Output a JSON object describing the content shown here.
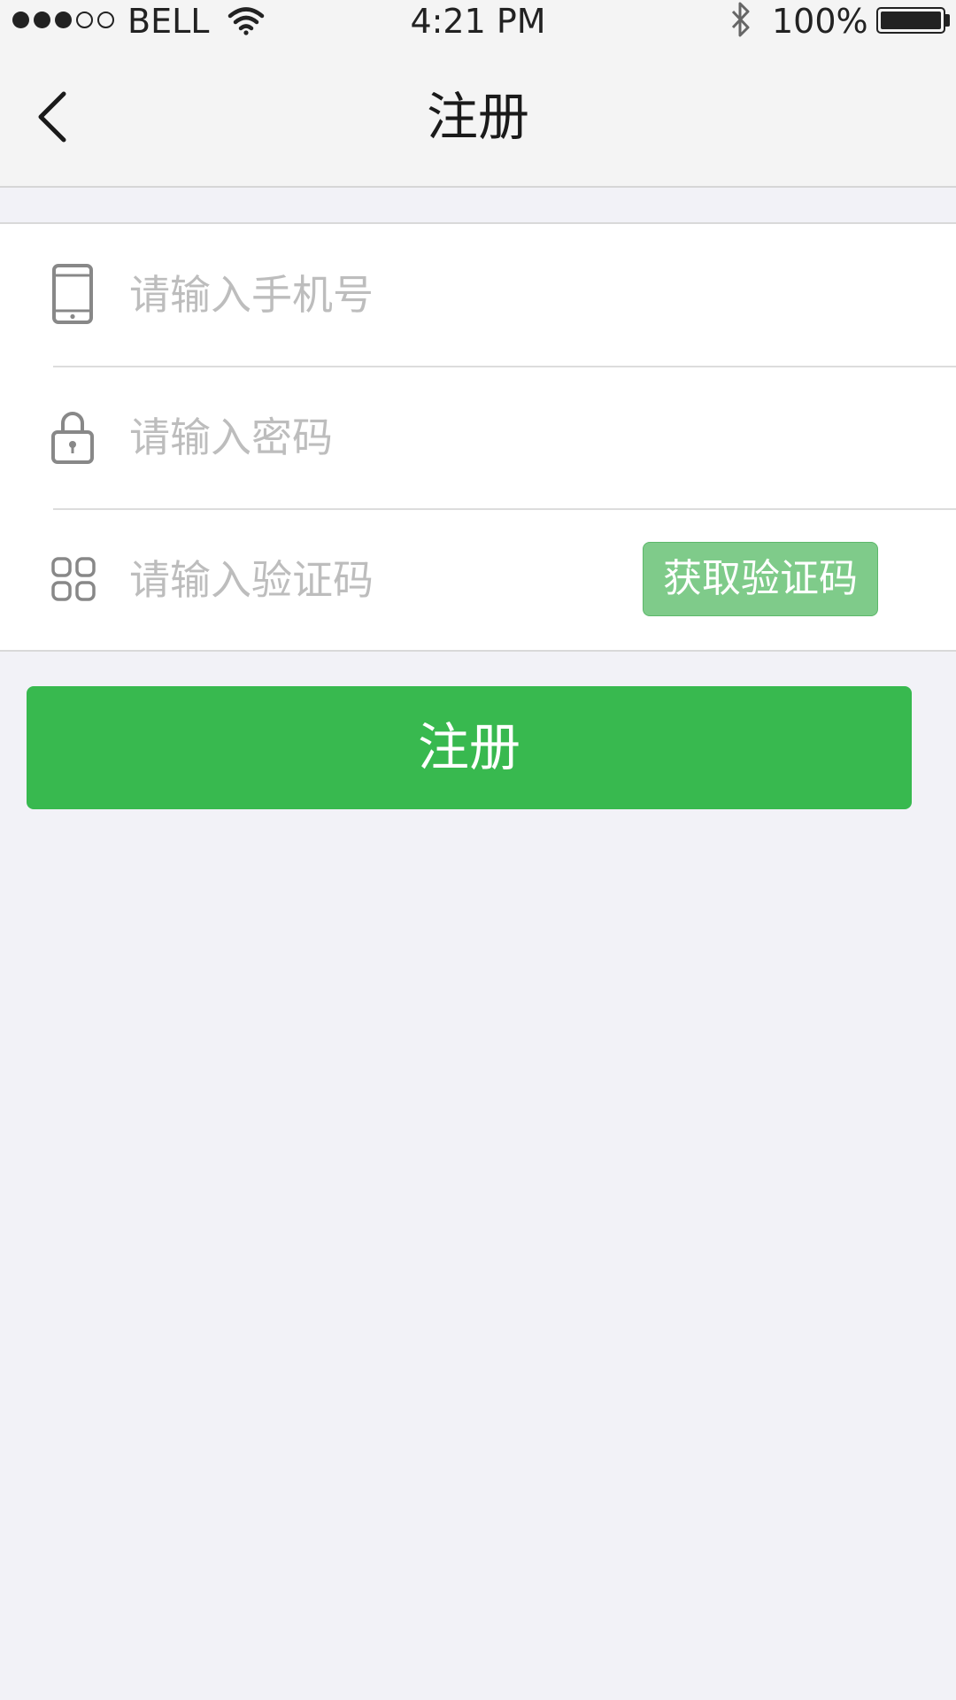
{
  "status_bar": {
    "carrier": "BELL",
    "time": "4:21 PM",
    "battery_percent": "100%",
    "signal_bars": 3,
    "signal_total": 5,
    "icons": [
      "wifi-icon",
      "bluetooth-icon",
      "battery-icon"
    ]
  },
  "nav": {
    "title": "注册",
    "back_icon": "chevron-left-icon"
  },
  "form": {
    "phone": {
      "placeholder": "请输入手机号",
      "value": "",
      "icon": "phone-icon"
    },
    "password": {
      "placeholder": "请输入密码",
      "value": "",
      "icon": "lock-icon"
    },
    "code": {
      "placeholder": "请输入验证码",
      "value": "",
      "icon": "grid-icon",
      "button_label": "获取验证码"
    }
  },
  "submit": {
    "label": "注册"
  },
  "colors": {
    "primary_green": "#38b94f",
    "code_button_green": "#7fcb8a",
    "background": "#f2f2f7",
    "placeholder_gray": "#bdbdbd",
    "icon_gray": "#888888"
  }
}
